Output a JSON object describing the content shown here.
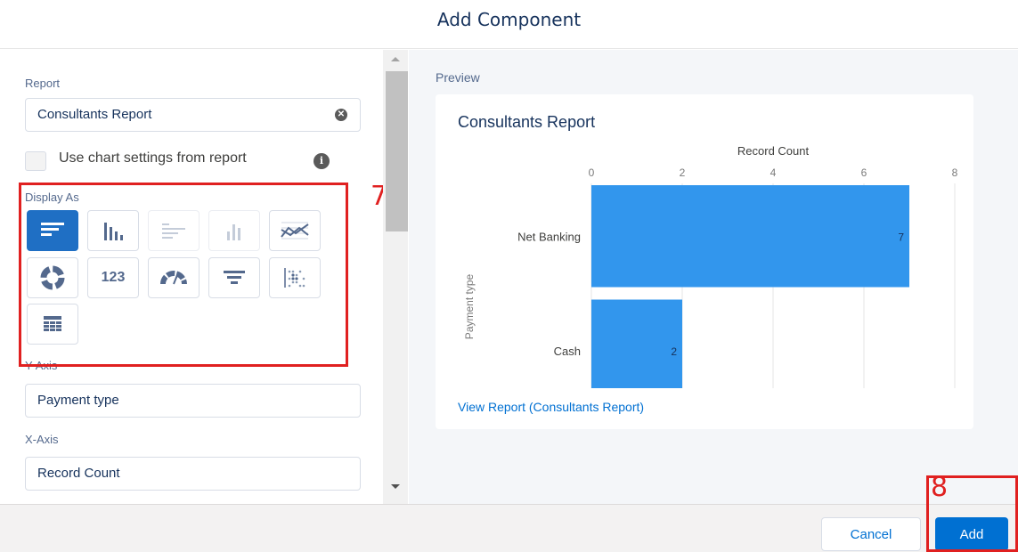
{
  "modal": {
    "title": "Add Component"
  },
  "left": {
    "report_label": "Report",
    "report_value": "Consultants Report",
    "use_chart_settings_label": "Use chart settings from report",
    "display_as_label": "Display As",
    "display_as_types": [
      "horizontal-bar",
      "vertical-bar",
      "stacked-horizontal-bar",
      "stacked-vertical-bar",
      "line",
      "donut",
      "metric",
      "gauge",
      "funnel",
      "scatter",
      "table"
    ],
    "display_as_selected": "horizontal-bar",
    "metric_text": "123",
    "y_axis_label": "Y-Axis",
    "y_axis_value": "Payment type",
    "x_axis_label": "X-Axis",
    "x_axis_value": "Record Count"
  },
  "annotations": {
    "step7": "7",
    "step8": "8"
  },
  "preview": {
    "label": "Preview",
    "view_report_link": "View Report (Consultants Report)"
  },
  "chart_data": {
    "type": "bar",
    "orientation": "horizontal",
    "title": "Consultants Report",
    "xlabel": "Record Count",
    "ylabel": "Payment type",
    "categories": [
      "Net Banking",
      "Cash"
    ],
    "values": [
      7,
      2
    ],
    "xlim": [
      0,
      8
    ],
    "xticks": [
      0,
      2,
      4,
      6,
      8
    ],
    "bar_color": "#3296ed",
    "grid": true
  },
  "footer": {
    "cancel_label": "Cancel",
    "add_label": "Add"
  },
  "colors": {
    "accent": "#0070d2",
    "annotation": "#e02020"
  }
}
